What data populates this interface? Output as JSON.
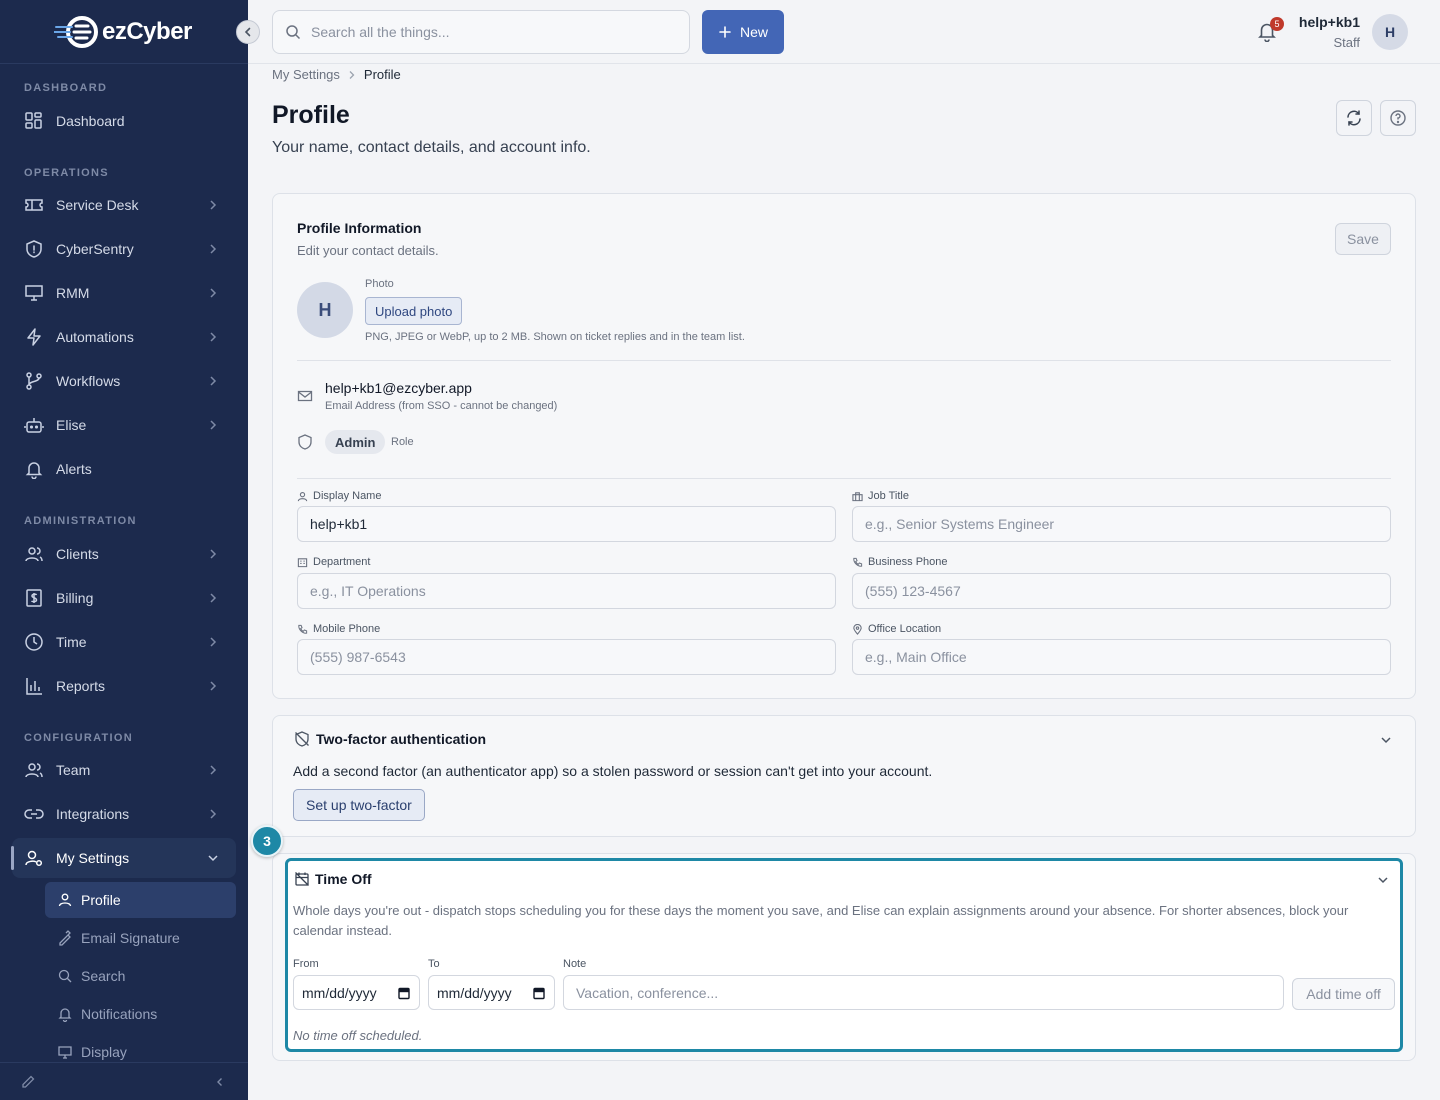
{
  "brand": {
    "name": "ezCyber"
  },
  "search": {
    "placeholder": "Search all the things..."
  },
  "new_button": {
    "label": "New"
  },
  "notifications": {
    "count": "5"
  },
  "user": {
    "name": "help+kb1",
    "role": "Staff",
    "initial": "H"
  },
  "sidebar": {
    "sections": [
      "DASHBOARD",
      "OPERATIONS",
      "ADMINISTRATION",
      "CONFIGURATION"
    ],
    "items": [
      {
        "label": "Dashboard",
        "icon": "grid-icon"
      },
      {
        "label": "Service Desk",
        "icon": "ticket-icon"
      },
      {
        "label": "CyberSentry",
        "icon": "shield-icon"
      },
      {
        "label": "RMM",
        "icon": "monitor-icon"
      },
      {
        "label": "Automations",
        "icon": "lightning-icon"
      },
      {
        "label": "Workflows",
        "icon": "branch-icon"
      },
      {
        "label": "Elise",
        "icon": "robot-icon"
      },
      {
        "label": "Alerts",
        "icon": "bell-icon"
      },
      {
        "label": "Clients",
        "icon": "users-icon"
      },
      {
        "label": "Billing",
        "icon": "dollar-icon"
      },
      {
        "label": "Time",
        "icon": "clock-icon"
      },
      {
        "label": "Reports",
        "icon": "bar-chart-icon"
      },
      {
        "label": "Team",
        "icon": "team-icon"
      },
      {
        "label": "Integrations",
        "icon": "link-icon"
      },
      {
        "label": "My Settings",
        "icon": "user-settings-icon"
      }
    ],
    "sub_items": [
      {
        "label": "Profile",
        "icon": "person-icon"
      },
      {
        "label": "Email Signature",
        "icon": "signature-icon"
      },
      {
        "label": "Search",
        "icon": "search-icon"
      },
      {
        "label": "Notifications",
        "icon": "bell-icon"
      },
      {
        "label": "Display",
        "icon": "display-icon"
      }
    ]
  },
  "breadcrumb": {
    "parent": "My Settings",
    "current": "Profile"
  },
  "page": {
    "title": "Profile",
    "subtitle": "Your name, contact details, and account info."
  },
  "profile_card": {
    "title": "Profile Information",
    "description": "Edit your contact details.",
    "save_label": "Save",
    "photo_label": "Photo",
    "avatar_initial": "H",
    "upload_label": "Upload photo",
    "photo_hint": "PNG, JPEG or WebP, up to 2 MB. Shown on ticket replies and in the team list.",
    "email": "help+kb1@ezcyber.app",
    "email_hint": "Email Address (from SSO - cannot be changed)",
    "role_chip": "Admin",
    "role_label": "Role",
    "fields": {
      "display_name": {
        "label": "Display Name",
        "value": "help+kb1",
        "placeholder": ""
      },
      "job_title": {
        "label": "Job Title",
        "value": "",
        "placeholder": "e.g., Senior Systems Engineer"
      },
      "department": {
        "label": "Department",
        "value": "",
        "placeholder": "e.g., IT Operations"
      },
      "business_phone": {
        "label": "Business Phone",
        "value": "",
        "placeholder": "(555) 123-4567"
      },
      "mobile_phone": {
        "label": "Mobile Phone",
        "value": "",
        "placeholder": "(555) 987-6543"
      },
      "office_location": {
        "label": "Office Location",
        "value": "",
        "placeholder": "e.g., Main Office"
      }
    }
  },
  "two_factor": {
    "title": "Two-factor authentication",
    "description": "Add a second factor (an authenticator app) so a stolen password or session can't get into your account.",
    "button": "Set up two-factor"
  },
  "time_off": {
    "step": "3",
    "title": "Time Off",
    "description": "Whole days you're out - dispatch stops scheduling you for these days the moment you save, and Elise can explain assignments around your absence. For shorter absences, block your calendar instead.",
    "from_label": "From",
    "to_label": "To",
    "note_label": "Note",
    "date_placeholder": "mm/dd/yyyy",
    "note_placeholder": "Vacation, conference...",
    "add_label": "Add time off",
    "empty": "No time off scheduled."
  },
  "colors": {
    "sidebar": "#1c2a4d",
    "accent": "#4366b6",
    "highlight": "#1e88a6"
  }
}
